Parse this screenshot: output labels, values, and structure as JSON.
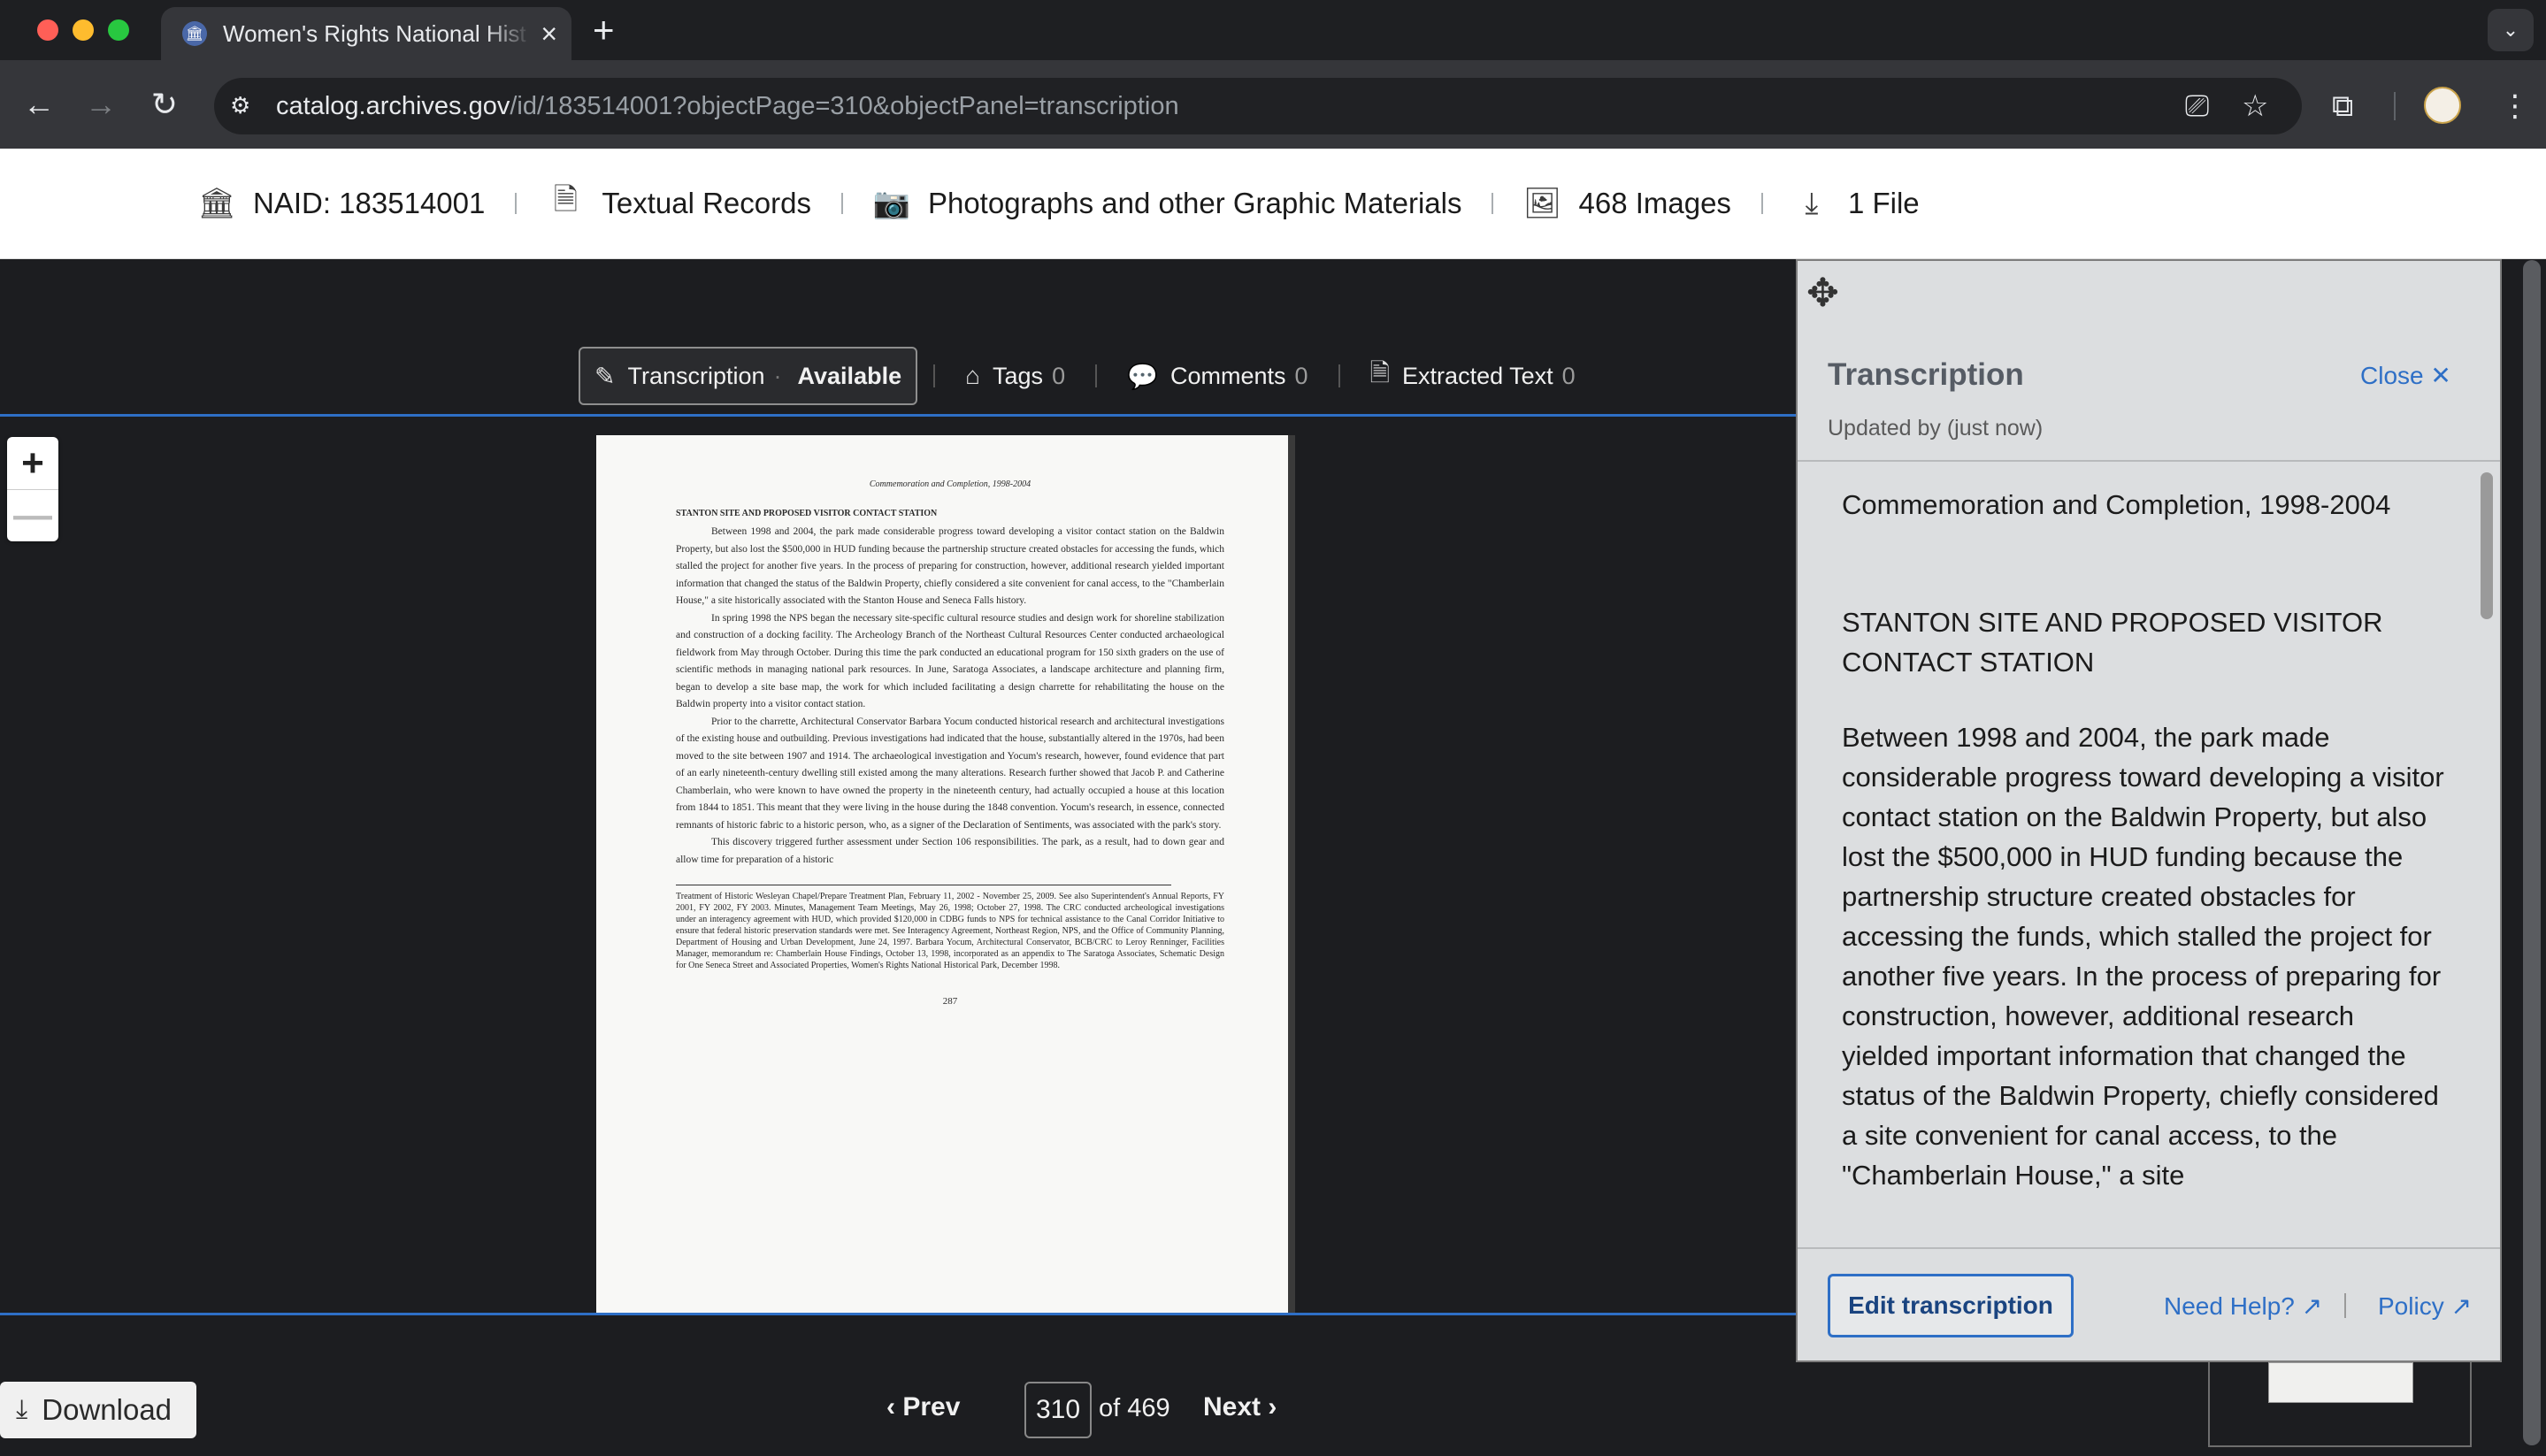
{
  "browser": {
    "tab_title": "Women's Rights National Hist",
    "tab_icon": "archives-icon",
    "url_host": "catalog.archives.gov",
    "url_path": "/id/183514001?objectPage=310&objectPanel=transcription"
  },
  "meta": {
    "naid": "NAID: 183514001",
    "textual": "Textual Records",
    "photos": "Photographs and other Graphic Materials",
    "images": "468 Images",
    "files": "1 File"
  },
  "viewer_toolbar": {
    "transcription_label": "Transcription",
    "transcription_status": "Available",
    "tags_label": "Tags",
    "tags_count": "0",
    "comments_label": "Comments",
    "comments_count": "0",
    "extracted_label": "Extracted Text",
    "extracted_count": "0"
  },
  "zoom": {
    "in": "+",
    "out": "—"
  },
  "document": {
    "header": "Commemoration and Completion, 1998-2004",
    "subheader": "STANTON SITE AND PROPOSED VISITOR CONTACT STATION",
    "p1": "Between 1998 and 2004, the park made considerable progress toward developing a visitor contact station on the Baldwin Property, but also lost the $500,000 in HUD funding because the partnership structure created obstacles for accessing the funds, which stalled the project for another five years. In the process of preparing for construction, however, additional research yielded important information that changed the status of the Baldwin Property, chiefly considered a site convenient for canal access, to the \"Chamberlain House,\" a site historically associated with the Stanton House and Seneca Falls history.",
    "p2": "In spring 1998 the NPS began the necessary site-specific cultural resource studies and design work for shoreline stabilization and construction of a docking facility. The Archeology Branch of the Northeast Cultural Resources Center conducted archaeological fieldwork from May through October. During this time the park conducted an educational program for 150 sixth graders on the use of scientific methods in managing national park resources. In June, Saratoga Associates, a landscape architecture and planning firm, began to develop a site base map, the work for which included facilitating a design charrette for rehabilitating the house on the Baldwin property into a visitor contact station.",
    "p3": "Prior to the charrette, Architectural Conservator Barbara Yocum conducted historical research and architectural investigations of the existing house and outbuilding. Previous investigations had indicated that the house, substantially altered in the 1970s, had been moved to the site between 1907 and 1914. The archaeological investigation and Yocum's research, however, found evidence that part of an early nineteenth-century dwelling still existed among the many alterations. Research further showed that Jacob P. and Catherine Chamberlain, who were known to have owned the property in the nineteenth century, had actually occupied a house at this location from 1844 to 1851. This meant that they were living in the house during the 1848 convention. Yocum's research, in essence, connected remnants of historic fabric to a historic person, who, as a signer of the Declaration of Sentiments, was associated with the park's story.",
    "p4": "This discovery triggered further assessment under Section 106 responsibilities. The park, as a result, had to down gear and allow time for preparation of a historic",
    "notes": "Treatment of Historic Wesleyan Chapel/Prepare Treatment Plan, February 11, 2002 - November 25, 2009. See also Superintendent's Annual Reports, FY 2001, FY 2002, FY 2003. Minutes, Management Team Meetings, May 26, 1998; October 27, 1998. The CRC conducted archeological investigations under an interagency agreement with HUD, which provided $120,000 in CDBG funds to NPS for technical assistance to the Canal Corridor Initiative to ensure that federal historic preservation standards were met. See Interagency Agreement, Northeast Region, NPS, and the Office of Community Planning, Department of Housing and Urban Development, June 24, 1997. Barbara Yocum, Architectural Conservator, BCB/CRC to Leroy Renninger, Facilities Manager, memorandum re: Chamberlain House Findings, October 13, 1998, incorporated as an appendix to The Saratoga Associates, Schematic Design for One Seneca Street and Associated Properties, Women's Rights National Historical Park, December 1998.",
    "page_number": "287"
  },
  "panel": {
    "title": "Transcription",
    "close_label": "Close ✕",
    "updated": "Updated by (just now)",
    "body_title": "Commemoration and Completion, 1998-2004",
    "body_subtitle": "STANTON SITE AND PROPOSED VISITOR CONTACT STATION",
    "body_text": "Between 1998 and 2004, the park made considerable progress toward developing a visitor contact station on the Baldwin Property, but also lost the $500,000 in HUD funding because the partnership structure created obstacles for accessing the funds, which stalled the project for another five years. In the process of preparing for construction, however, additional research yielded important information that changed the status of the Baldwin Property, chiefly considered a site convenient for canal access, to the \"Chamberlain House,\" a site",
    "edit_label": "Edit transcription",
    "help_label": "Need Help? ↗",
    "policy_label": "Policy ↗"
  },
  "pager": {
    "download_label": "Download",
    "prev_label": "‹  Prev",
    "page_value": "310",
    "of_label": "of 469",
    "next_label": "Next  ›"
  },
  "colors": {
    "accent": "#2e6fc6",
    "viewer_bg": "#1c1d20",
    "panel_bg": "#dcdee0"
  }
}
